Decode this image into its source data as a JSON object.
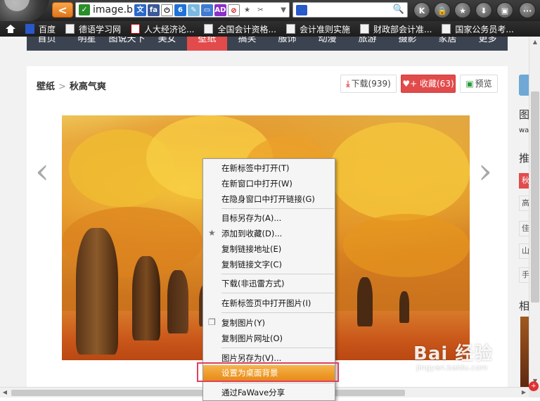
{
  "browser": {
    "back_label": "<",
    "url": "image.b",
    "address_chevron": "▼",
    "toolbar_buttons": [
      "K",
      "🔒",
      "★",
      "⬇",
      "▣",
      "···"
    ]
  },
  "bookmarks": [
    {
      "label": "百度",
      "icon": "baidu-paw-icon"
    },
    {
      "label": "德语学习网",
      "icon": "page-icon"
    },
    {
      "label": "人大经济论...",
      "icon": "red-e-icon"
    },
    {
      "label": "全国会计资格...",
      "icon": "page-icon"
    },
    {
      "label": "会计准则实施",
      "icon": "page-icon"
    },
    {
      "label": "财政部会计准...",
      "icon": "page-icon"
    },
    {
      "label": "国家公务员考...",
      "icon": "page-icon"
    }
  ],
  "nav": {
    "items": [
      "首页",
      "明星",
      "图说天下",
      "美女",
      "壁纸",
      "搞笑",
      "服饰",
      "动漫",
      "旅游",
      "摄影",
      "家居",
      "更多"
    ],
    "active": "壁纸"
  },
  "breadcrumb": {
    "root": "壁纸",
    "sep": ">",
    "current": "秋高气爽"
  },
  "actions": {
    "download": "下载(939)",
    "favorite": "收藏(63)",
    "preview": "预览"
  },
  "arrows": {
    "prev": "‹",
    "next": "›"
  },
  "side": {
    "title1": "图",
    "title1_sub": "wa",
    "title2": "推",
    "tags": [
      "秋",
      "高",
      "佳",
      "山",
      "手"
    ],
    "title3": "相"
  },
  "context_menu": {
    "items": [
      {
        "label": "在新标签中打开(T)",
        "icon": ""
      },
      {
        "label": "在新窗口中打开(W)",
        "icon": ""
      },
      {
        "label": "在隐身窗口中打开链接(G)",
        "icon": ""
      },
      {
        "label": "目标另存为(A)...",
        "icon": ""
      },
      {
        "label": "添加到收藏(D)...",
        "icon": "star-icon"
      },
      {
        "label": "复制链接地址(E)",
        "icon": ""
      },
      {
        "label": "复制链接文字(C)",
        "icon": ""
      },
      {
        "label": "下载(非迅雷方式)",
        "icon": ""
      },
      {
        "label": "在新标签页中打开图片(I)",
        "icon": ""
      },
      {
        "label": "复制图片(Y)",
        "icon": "copy-icon"
      },
      {
        "label": "复制图片网址(O)",
        "icon": ""
      },
      {
        "label": "图片另存为(V)...",
        "icon": ""
      },
      {
        "label": "设置为桌面背景",
        "icon": ""
      },
      {
        "label": "通过FaWave分享",
        "icon": ""
      }
    ],
    "highlighted": "设置为桌面背景"
  },
  "watermark": {
    "brand": "Bai 经验",
    "url": "jingyan.baidu.com"
  },
  "colors": {
    "accent": "#e24b4b",
    "nav_bg": "#3c4350",
    "menu_highlight": "#e88a18",
    "highlight_box": "#e04060"
  }
}
